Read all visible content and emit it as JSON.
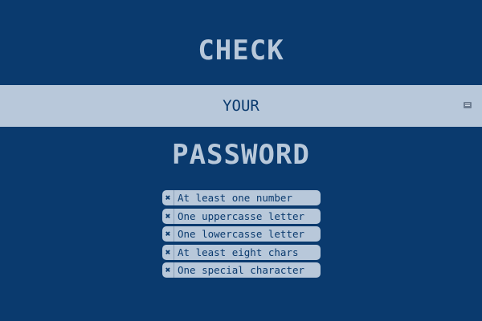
{
  "heading": {
    "top": "CHECK",
    "bottom": "PASSWORD"
  },
  "password_field": {
    "placeholder": "YOUR",
    "value": "",
    "keyboard_icon": "keyboard-icon"
  },
  "requirements": [
    {
      "label": "At least one number",
      "status": "unmet",
      "icon": "x-icon",
      "glyph": "✖"
    },
    {
      "label": "One uppercasse letter",
      "status": "unmet",
      "icon": "x-icon",
      "glyph": "✖"
    },
    {
      "label": "One lowercasse letter",
      "status": "unmet",
      "icon": "x-icon",
      "glyph": "✖"
    },
    {
      "label": "At least eight chars",
      "status": "unmet",
      "icon": "x-icon",
      "glyph": "✖"
    },
    {
      "label": "One special character",
      "status": "unmet",
      "icon": "x-icon",
      "glyph": "✖"
    }
  ],
  "colors": {
    "background": "#0a3a6e",
    "accent": "#b8c8da"
  }
}
